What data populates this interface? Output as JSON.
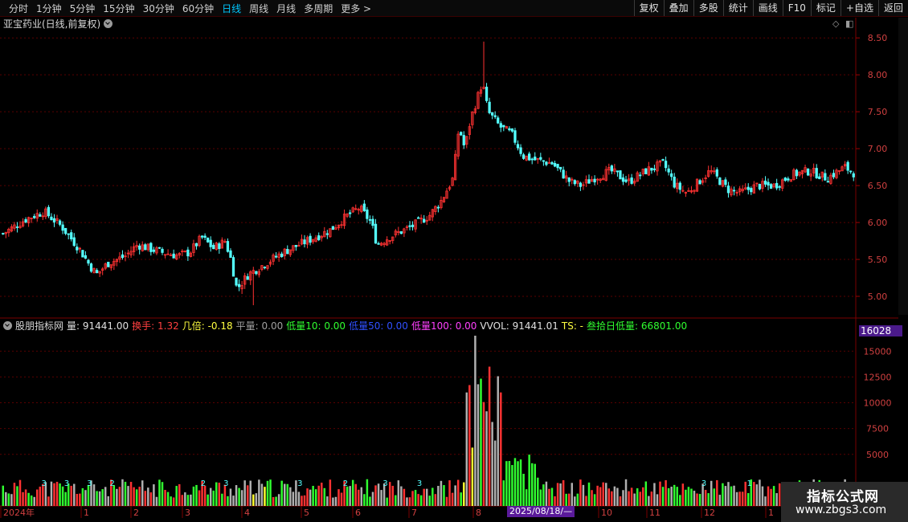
{
  "toolbar": {
    "periods": [
      "分时",
      "1分钟",
      "5分钟",
      "15分钟",
      "30分钟",
      "60分钟",
      "日线",
      "周线",
      "月线",
      "多周期",
      "更多 >"
    ],
    "active_period": "日线",
    "actions": [
      "复权",
      "叠加",
      "多股",
      "统计",
      "画线",
      "F10",
      "标记",
      "+自选",
      "返回"
    ]
  },
  "main_chart": {
    "title": "亚宝药业(日线,前复权)",
    "y_ticks": [
      "8.50",
      "8.00",
      "7.50",
      "7.00",
      "6.50",
      "6.00",
      "5.50",
      "5.00"
    ],
    "up_color": "#ff3232",
    "down_color": "#54ffff"
  },
  "indicator": {
    "name": "股朋指标网",
    "items": [
      {
        "label": "量: 91441.00",
        "color": "#e0e0e0"
      },
      {
        "label": "换手: 1.32",
        "color": "#ff4040"
      },
      {
        "label": "几倍: -0.18",
        "color": "#ffff40"
      },
      {
        "label": "平量: 0.00",
        "color": "#a0a0a0"
      },
      {
        "label": "低量10: 0.00",
        "color": "#30ff30"
      },
      {
        "label": "低量50: 0.00",
        "color": "#3050ff"
      },
      {
        "label": "低量100: 0.00",
        "color": "#ff40ff"
      },
      {
        "label": "VVOL: 91441.01",
        "color": "#e0e0e0"
      },
      {
        "label": "TS: -",
        "color": "#ffff40"
      },
      {
        "label": "叁拾日低量: 66801.00",
        "color": "#30ff30"
      }
    ],
    "y_ticks": [
      "15000",
      "12500",
      "10000",
      "7500",
      "5000"
    ],
    "current_value": "16028"
  },
  "x_axis": {
    "labels": [
      "2024年",
      "1",
      "2",
      "3",
      "4",
      "5",
      "6",
      "7",
      "8",
      "10",
      "11",
      "12",
      "1"
    ],
    "cursor_date": "2025/08/18/—"
  },
  "watermark": {
    "title": "指标公式网",
    "url": "www.zbgs3.com"
  },
  "chart_data": {
    "type": "candlestick",
    "title": "亚宝药业(日线,前复权)",
    "ylim": [
      4.75,
      8.6
    ],
    "close_path": [
      [
        0,
        5.85
      ],
      [
        8,
        6.05
      ],
      [
        14,
        6.15
      ],
      [
        20,
        5.95
      ],
      [
        26,
        5.65
      ],
      [
        30,
        5.4
      ],
      [
        32,
        5.3
      ],
      [
        36,
        5.45
      ],
      [
        42,
        5.55
      ],
      [
        46,
        5.7
      ],
      [
        54,
        5.6
      ],
      [
        60,
        5.55
      ],
      [
        64,
        5.6
      ],
      [
        68,
        5.8
      ],
      [
        72,
        5.65
      ],
      [
        76,
        5.75
      ],
      [
        78,
        5.5
      ],
      [
        80,
        5.1
      ],
      [
        84,
        5.3
      ],
      [
        90,
        5.45
      ],
      [
        96,
        5.6
      ],
      [
        104,
        5.75
      ],
      [
        112,
        5.9
      ],
      [
        118,
        6.1
      ],
      [
        122,
        6.2
      ],
      [
        126,
        6.0
      ],
      [
        128,
        5.7
      ],
      [
        132,
        5.8
      ],
      [
        140,
        5.95
      ],
      [
        146,
        6.1
      ],
      [
        150,
        6.3
      ],
      [
        154,
        6.6
      ],
      [
        156,
        7.3
      ],
      [
        158,
        7.0
      ],
      [
        160,
        7.4
      ],
      [
        164,
        7.9
      ],
      [
        166,
        7.5
      ],
      [
        170,
        7.3
      ],
      [
        174,
        7.2
      ],
      [
        178,
        6.9
      ],
      [
        182,
        6.85
      ],
      [
        188,
        6.8
      ],
      [
        194,
        6.55
      ],
      [
        198,
        6.5
      ],
      [
        202,
        6.6
      ],
      [
        208,
        6.7
      ],
      [
        214,
        6.55
      ],
      [
        220,
        6.7
      ],
      [
        226,
        6.8
      ],
      [
        230,
        6.5
      ],
      [
        234,
        6.4
      ],
      [
        238,
        6.55
      ],
      [
        242,
        6.7
      ],
      [
        248,
        6.45
      ],
      [
        252,
        6.4
      ],
      [
        258,
        6.5
      ],
      [
        264,
        6.5
      ],
      [
        270,
        6.65
      ],
      [
        276,
        6.7
      ],
      [
        282,
        6.6
      ],
      [
        288,
        6.75
      ],
      [
        292,
        6.65
      ]
    ],
    "volume_ylim": [
      0,
      16500
    ]
  }
}
